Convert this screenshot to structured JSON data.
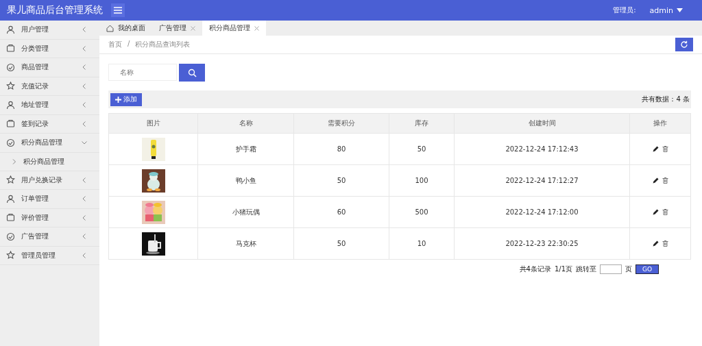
{
  "header": {
    "title": "果儿商品后台管理系统",
    "user_label": "管理员:",
    "user_name": "admin"
  },
  "sidebar": {
    "items": [
      {
        "label": "用户管理",
        "expanded": false
      },
      {
        "label": "分类管理",
        "expanded": false
      },
      {
        "label": "商品管理",
        "expanded": false
      },
      {
        "label": "充值记录",
        "expanded": false
      },
      {
        "label": "地址管理",
        "expanded": false
      },
      {
        "label": "签到记录",
        "expanded": false
      },
      {
        "label": "积分商品管理",
        "expanded": true,
        "children": [
          {
            "label": "积分商品管理"
          }
        ]
      },
      {
        "label": "用户兑换记录",
        "expanded": false
      },
      {
        "label": "订单管理",
        "expanded": false
      },
      {
        "label": "评价管理",
        "expanded": false
      },
      {
        "label": "广告管理",
        "expanded": false
      },
      {
        "label": "管理员管理",
        "expanded": false
      }
    ]
  },
  "tabs": [
    {
      "label": "我的桌面",
      "selected": false,
      "closable": false
    },
    {
      "label": "广告管理",
      "selected": false,
      "closable": true
    },
    {
      "label": "积分商品管理",
      "selected": true,
      "closable": true
    }
  ],
  "breadcrumb": [
    "首页",
    "积分商品查询列表"
  ],
  "breadcrumb_separator": "/",
  "search": {
    "placeholder": "名称"
  },
  "toolbar": {
    "add_button": "添加",
    "total": "共有数据：4 条"
  },
  "table": {
    "columns": [
      "图片",
      "名称",
      "需要积分",
      "库存",
      "创建时间",
      "操作"
    ],
    "rows": [
      {
        "name": "护手霜",
        "points": "80",
        "stock": "50",
        "created": "2022-12-24 17:12:43"
      },
      {
        "name": "鸭小鱼",
        "points": "50",
        "stock": "100",
        "created": "2022-12-24 17:12:27"
      },
      {
        "name": "小猪玩偶",
        "points": "60",
        "stock": "500",
        "created": "2022-12-24 17:12:00"
      },
      {
        "name": "马克杯",
        "points": "50",
        "stock": "10",
        "created": "2022-12-23 22:30:25"
      }
    ]
  },
  "pagination": {
    "records": "共4条记录",
    "pages": "1/1页",
    "jump_label": "跳转至",
    "page_unit": "页",
    "go_button": "GO"
  }
}
